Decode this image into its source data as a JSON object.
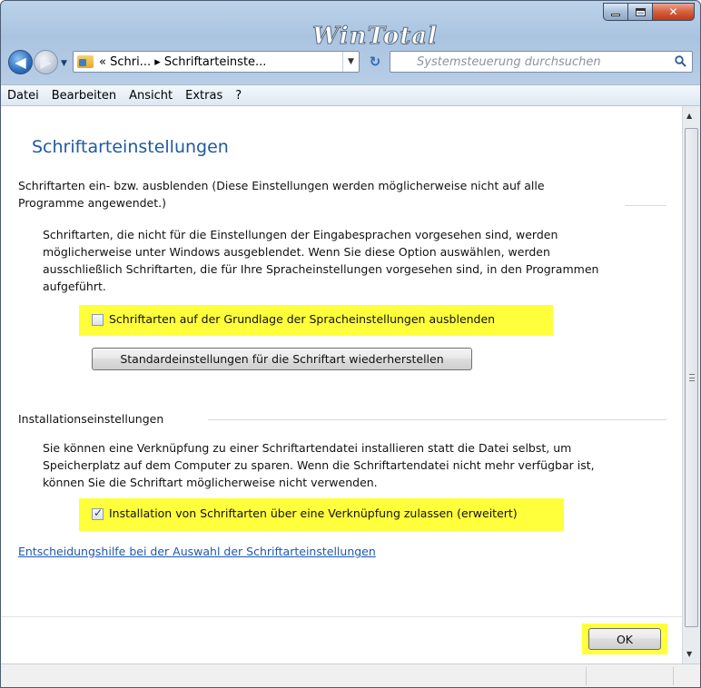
{
  "window": {
    "watermark": "WinTotal",
    "caption_buttons": {
      "minimize": "minimize",
      "maximize": "maximize",
      "close": "✕"
    }
  },
  "nav": {
    "address_crumbs": "« Schri... ▸ Schriftarteinste...",
    "address_dropdown": "▼",
    "refresh_glyph": "↻",
    "back_glyph": "◀",
    "forward_glyph": "▶",
    "recent_glyph": "▼",
    "search_placeholder": "Systemsteuerung durchsuchen"
  },
  "menubar": {
    "items": [
      "Datei",
      "Bearbeiten",
      "Ansicht",
      "Extras",
      "?"
    ]
  },
  "main": {
    "title": "Schriftarteinstellungen",
    "section1": {
      "heading_line1": "Schriftarten ein- bzw. ausblenden (Diese Einstellungen werden möglicherweise nicht auf alle",
      "heading_line2": "Programme angewendet.)",
      "desc_line1": "Schriftarten, die nicht für die Einstellungen der Eingabesprachen vorgesehen sind, werden",
      "desc_line2": "möglicherweise unter Windows ausgeblendet. Wenn Sie diese Option auswählen, werden",
      "desc_line3": "ausschließlich Schriftarten, die für Ihre Spracheinstellungen vorgesehen sind, in den Programmen",
      "desc_line4": "aufgeführt.",
      "checkbox_label": "Schriftarten auf der Grundlage der Spracheinstellungen ausblenden",
      "checkbox_checked": false,
      "restore_button": "Standardeinstellungen für die Schriftart wiederherstellen"
    },
    "section2": {
      "heading": "Installationseinstellungen",
      "desc_line1": "Sie können eine Verknüpfung zu einer Schriftartendatei installieren statt die Datei selbst, um",
      "desc_line2": "Speicherplatz auf dem Computer zu sparen. Wenn die Schriftartendatei nicht mehr verfügbar ist,",
      "desc_line3": "können Sie die Schriftart möglicherweise nicht verwenden.",
      "checkbox_label": "Installation von Schriftarten über eine Verknüpfung zulassen (erweitert)",
      "checkbox_checked": true
    },
    "help_link": "Entscheidungshilfe bei der Auswahl der Schriftarteinstellungen",
    "ok_button": "OK"
  },
  "colors": {
    "highlight": "#ffff3b",
    "title_blue": "#1e5aa0",
    "link_blue": "#1e58b0"
  }
}
